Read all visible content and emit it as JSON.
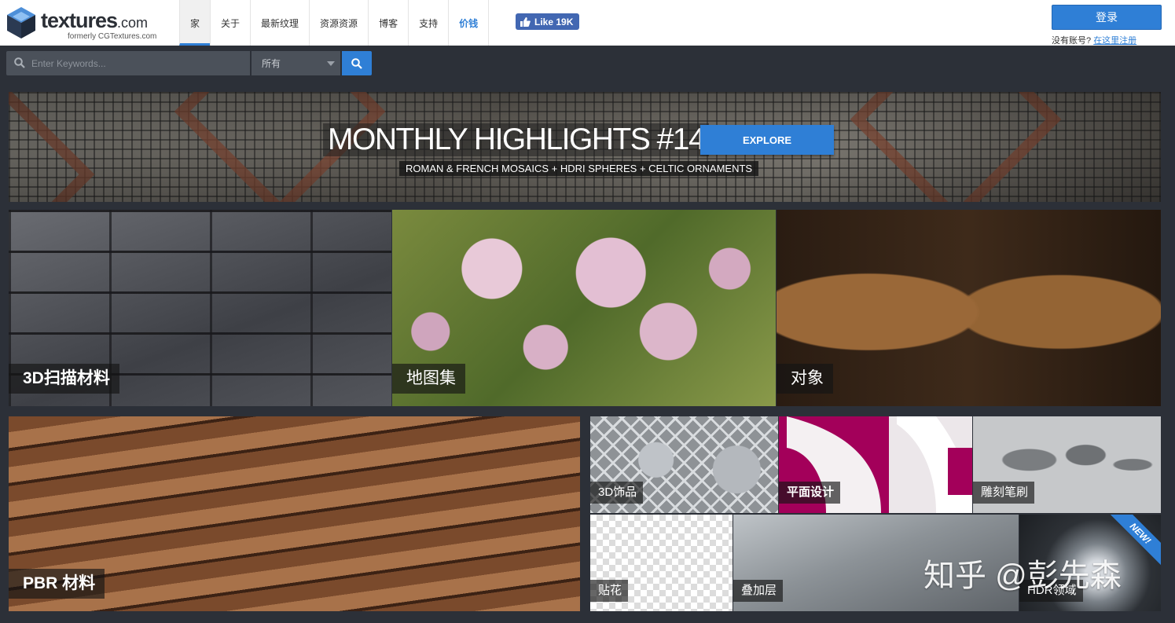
{
  "header": {
    "logo": {
      "word": "textures",
      "suffix": ".com",
      "sub": "formerly CGTextures.com",
      "icon": "cube-logo-icon"
    },
    "nav": [
      {
        "label": "家",
        "active": true
      },
      {
        "label": "关于"
      },
      {
        "label": "最新纹理"
      },
      {
        "label": "资源资源"
      },
      {
        "label": "博客"
      },
      {
        "label": "支持"
      },
      {
        "label": "价钱",
        "highlight": true
      }
    ],
    "fb_like": {
      "label": "Like 19K",
      "icon": "thumbs-up-icon"
    },
    "login_label": "登录",
    "register_prompt": "没有账号?",
    "register_link": "在这里注册"
  },
  "search": {
    "placeholder": "Enter Keywords...",
    "category_selected": "所有",
    "icon": "search-icon"
  },
  "banner": {
    "title": "MONTHLY HIGHLIGHTS #14",
    "subtitle": "ROMAN & FRENCH MOSAICS + HDRI SPHERES + CELTIC ORNAMENTS",
    "button": "EXPLORE"
  },
  "tiles": {
    "scan": "3D扫描材料",
    "atlas": "地图集",
    "objects": "对象",
    "pbr": "PBR 材料",
    "ornaments": "3D饰品",
    "flat": "平面设计",
    "brushes": "雕刻笔刷",
    "decals": "贴花",
    "overlays": "叠加层",
    "hdri": "HDR领域",
    "hdri_badge": "NEW!"
  },
  "watermark": "知乎 @彭先森",
  "colors": {
    "accent": "#2f7fd6",
    "background": "#2c3038",
    "flat_magenta": "#a3005a"
  }
}
